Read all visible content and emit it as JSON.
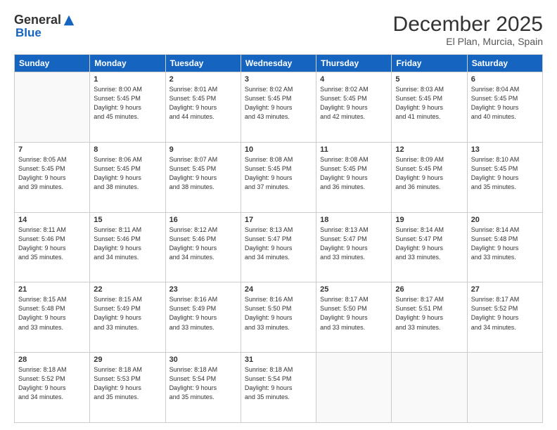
{
  "logo": {
    "general": "General",
    "blue": "Blue"
  },
  "title": "December 2025",
  "subtitle": "El Plan, Murcia, Spain",
  "days_of_week": [
    "Sunday",
    "Monday",
    "Tuesday",
    "Wednesday",
    "Thursday",
    "Friday",
    "Saturday"
  ],
  "weeks": [
    [
      {
        "day": "",
        "info": ""
      },
      {
        "day": "1",
        "info": "Sunrise: 8:00 AM\nSunset: 5:45 PM\nDaylight: 9 hours\nand 45 minutes."
      },
      {
        "day": "2",
        "info": "Sunrise: 8:01 AM\nSunset: 5:45 PM\nDaylight: 9 hours\nand 44 minutes."
      },
      {
        "day": "3",
        "info": "Sunrise: 8:02 AM\nSunset: 5:45 PM\nDaylight: 9 hours\nand 43 minutes."
      },
      {
        "day": "4",
        "info": "Sunrise: 8:02 AM\nSunset: 5:45 PM\nDaylight: 9 hours\nand 42 minutes."
      },
      {
        "day": "5",
        "info": "Sunrise: 8:03 AM\nSunset: 5:45 PM\nDaylight: 9 hours\nand 41 minutes."
      },
      {
        "day": "6",
        "info": "Sunrise: 8:04 AM\nSunset: 5:45 PM\nDaylight: 9 hours\nand 40 minutes."
      }
    ],
    [
      {
        "day": "7",
        "info": "Sunrise: 8:05 AM\nSunset: 5:45 PM\nDaylight: 9 hours\nand 39 minutes."
      },
      {
        "day": "8",
        "info": "Sunrise: 8:06 AM\nSunset: 5:45 PM\nDaylight: 9 hours\nand 38 minutes."
      },
      {
        "day": "9",
        "info": "Sunrise: 8:07 AM\nSunset: 5:45 PM\nDaylight: 9 hours\nand 38 minutes."
      },
      {
        "day": "10",
        "info": "Sunrise: 8:08 AM\nSunset: 5:45 PM\nDaylight: 9 hours\nand 37 minutes."
      },
      {
        "day": "11",
        "info": "Sunrise: 8:08 AM\nSunset: 5:45 PM\nDaylight: 9 hours\nand 36 minutes."
      },
      {
        "day": "12",
        "info": "Sunrise: 8:09 AM\nSunset: 5:45 PM\nDaylight: 9 hours\nand 36 minutes."
      },
      {
        "day": "13",
        "info": "Sunrise: 8:10 AM\nSunset: 5:45 PM\nDaylight: 9 hours\nand 35 minutes."
      }
    ],
    [
      {
        "day": "14",
        "info": "Sunrise: 8:11 AM\nSunset: 5:46 PM\nDaylight: 9 hours\nand 35 minutes."
      },
      {
        "day": "15",
        "info": "Sunrise: 8:11 AM\nSunset: 5:46 PM\nDaylight: 9 hours\nand 34 minutes."
      },
      {
        "day": "16",
        "info": "Sunrise: 8:12 AM\nSunset: 5:46 PM\nDaylight: 9 hours\nand 34 minutes."
      },
      {
        "day": "17",
        "info": "Sunrise: 8:13 AM\nSunset: 5:47 PM\nDaylight: 9 hours\nand 34 minutes."
      },
      {
        "day": "18",
        "info": "Sunrise: 8:13 AM\nSunset: 5:47 PM\nDaylight: 9 hours\nand 33 minutes."
      },
      {
        "day": "19",
        "info": "Sunrise: 8:14 AM\nSunset: 5:47 PM\nDaylight: 9 hours\nand 33 minutes."
      },
      {
        "day": "20",
        "info": "Sunrise: 8:14 AM\nSunset: 5:48 PM\nDaylight: 9 hours\nand 33 minutes."
      }
    ],
    [
      {
        "day": "21",
        "info": "Sunrise: 8:15 AM\nSunset: 5:48 PM\nDaylight: 9 hours\nand 33 minutes."
      },
      {
        "day": "22",
        "info": "Sunrise: 8:15 AM\nSunset: 5:49 PM\nDaylight: 9 hours\nand 33 minutes."
      },
      {
        "day": "23",
        "info": "Sunrise: 8:16 AM\nSunset: 5:49 PM\nDaylight: 9 hours\nand 33 minutes."
      },
      {
        "day": "24",
        "info": "Sunrise: 8:16 AM\nSunset: 5:50 PM\nDaylight: 9 hours\nand 33 minutes."
      },
      {
        "day": "25",
        "info": "Sunrise: 8:17 AM\nSunset: 5:50 PM\nDaylight: 9 hours\nand 33 minutes."
      },
      {
        "day": "26",
        "info": "Sunrise: 8:17 AM\nSunset: 5:51 PM\nDaylight: 9 hours\nand 33 minutes."
      },
      {
        "day": "27",
        "info": "Sunrise: 8:17 AM\nSunset: 5:52 PM\nDaylight: 9 hours\nand 34 minutes."
      }
    ],
    [
      {
        "day": "28",
        "info": "Sunrise: 8:18 AM\nSunset: 5:52 PM\nDaylight: 9 hours\nand 34 minutes."
      },
      {
        "day": "29",
        "info": "Sunrise: 8:18 AM\nSunset: 5:53 PM\nDaylight: 9 hours\nand 35 minutes."
      },
      {
        "day": "30",
        "info": "Sunrise: 8:18 AM\nSunset: 5:54 PM\nDaylight: 9 hours\nand 35 minutes."
      },
      {
        "day": "31",
        "info": "Sunrise: 8:18 AM\nSunset: 5:54 PM\nDaylight: 9 hours\nand 35 minutes."
      },
      {
        "day": "",
        "info": ""
      },
      {
        "day": "",
        "info": ""
      },
      {
        "day": "",
        "info": ""
      }
    ]
  ]
}
